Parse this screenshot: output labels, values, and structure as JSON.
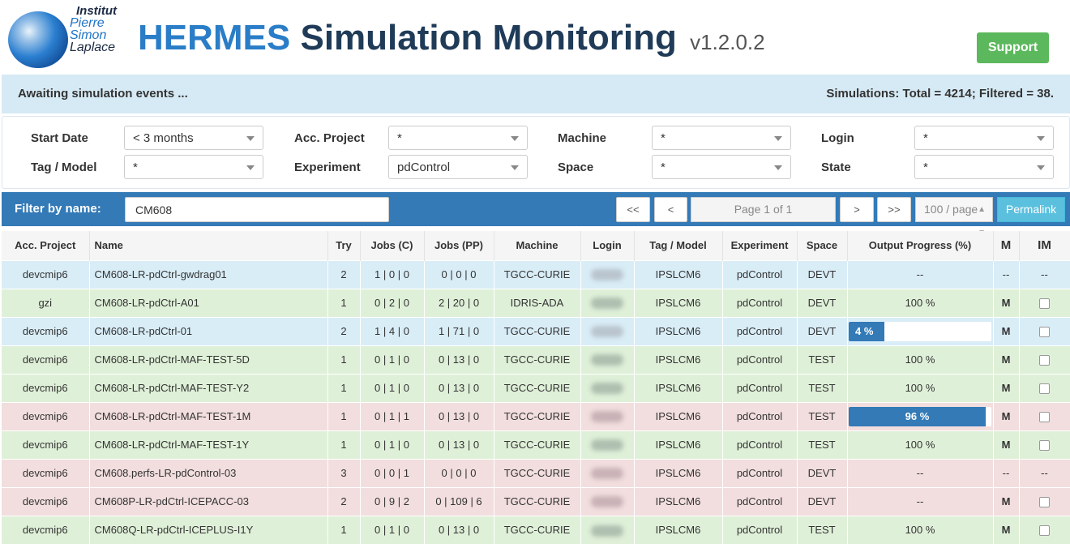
{
  "header": {
    "logo_lines": [
      "Institut",
      "Pierre",
      "Simon",
      "Laplace"
    ],
    "title_part1": "HERMES",
    "title_part2": "Simulation Monitoring",
    "version": "v1.2.0.2",
    "support_label": "Support"
  },
  "status": {
    "left": "Awaiting simulation events ...",
    "right": "Simulations: Total = 4214; Filtered = 38."
  },
  "filters": {
    "start_date": {
      "label": "Start Date",
      "value": "< 3 months"
    },
    "acc_project": {
      "label": "Acc. Project",
      "value": "*"
    },
    "machine": {
      "label": "Machine",
      "value": "*"
    },
    "login": {
      "label": "Login",
      "value": "*"
    },
    "tag_model": {
      "label": "Tag / Model",
      "value": "*"
    },
    "experiment": {
      "label": "Experiment",
      "value": "pdControl"
    },
    "space": {
      "label": "Space",
      "value": "*"
    },
    "state": {
      "label": "State",
      "value": "*"
    }
  },
  "nav": {
    "filter_label": "Filter by name:",
    "filter_value": "CM608",
    "first": "<<",
    "prev": "<",
    "page_info": "Page 1 of 1",
    "next": ">",
    "last": ">>",
    "per_page": "100 / page",
    "permalink": "Permalink"
  },
  "table": {
    "columns": [
      "Acc. Project",
      "Name",
      "Try",
      "Jobs (C)",
      "Jobs (PP)",
      "Machine",
      "Login",
      "Tag / Model",
      "Experiment",
      "Space",
      "Output Progress (%)",
      "M",
      "IM"
    ],
    "rows": [
      {
        "status": "blue",
        "project": "devcmip6",
        "name": "CM608-LR-pdCtrl-gwdrag01",
        "try": "2",
        "jobs_c": "1 | 0 | 0",
        "jobs_pp": "0 | 0 | 0",
        "machine": "TGCC-CURIE",
        "tag": "IPSLCM6",
        "experiment": "pdControl",
        "space": "DEVT",
        "progress_text": "--",
        "progress_value": null,
        "m": "--",
        "im": "--"
      },
      {
        "status": "green",
        "project": "gzi",
        "name": "CM608-LR-pdCtrl-A01",
        "try": "1",
        "jobs_c": "0 | 2 | 0",
        "jobs_pp": "2 | 20 | 0",
        "machine": "IDRIS-ADA",
        "tag": "IPSLCM6",
        "experiment": "pdControl",
        "space": "DEVT",
        "progress_text": "100 %",
        "progress_value": null,
        "m": "M",
        "im": "checkbox"
      },
      {
        "status": "blue",
        "project": "devcmip6",
        "name": "CM608-LR-pdCtrl-01",
        "try": "2",
        "jobs_c": "1 | 4 | 0",
        "jobs_pp": "1 | 71 | 0",
        "machine": "TGCC-CURIE",
        "tag": "IPSLCM6",
        "experiment": "pdControl",
        "space": "DEVT",
        "progress_text": "4 %",
        "progress_value": 4,
        "m": "M",
        "im": "checkbox"
      },
      {
        "status": "green",
        "project": "devcmip6",
        "name": "CM608-LR-pdCtrl-MAF-TEST-5D",
        "try": "1",
        "jobs_c": "0 | 1 | 0",
        "jobs_pp": "0 | 13 | 0",
        "machine": "TGCC-CURIE",
        "tag": "IPSLCM6",
        "experiment": "pdControl",
        "space": "TEST",
        "progress_text": "100 %",
        "progress_value": null,
        "m": "M",
        "im": "checkbox"
      },
      {
        "status": "green",
        "project": "devcmip6",
        "name": "CM608-LR-pdCtrl-MAF-TEST-Y2",
        "try": "1",
        "jobs_c": "0 | 1 | 0",
        "jobs_pp": "0 | 13 | 0",
        "machine": "TGCC-CURIE",
        "tag": "IPSLCM6",
        "experiment": "pdControl",
        "space": "TEST",
        "progress_text": "100 %",
        "progress_value": null,
        "m": "M",
        "im": "checkbox"
      },
      {
        "status": "red",
        "project": "devcmip6",
        "name": "CM608-LR-pdCtrl-MAF-TEST-1M",
        "try": "1",
        "jobs_c": "0 | 1 | 1",
        "jobs_pp": "0 | 13 | 0",
        "machine": "TGCC-CURIE",
        "tag": "IPSLCM6",
        "experiment": "pdControl",
        "space": "TEST",
        "progress_text": "96 %",
        "progress_value": 96,
        "m": "M",
        "im": "checkbox"
      },
      {
        "status": "green",
        "project": "devcmip6",
        "name": "CM608-LR-pdCtrl-MAF-TEST-1Y",
        "try": "1",
        "jobs_c": "0 | 1 | 0",
        "jobs_pp": "0 | 13 | 0",
        "machine": "TGCC-CURIE",
        "tag": "IPSLCM6",
        "experiment": "pdControl",
        "space": "TEST",
        "progress_text": "100 %",
        "progress_value": null,
        "m": "M",
        "im": "checkbox"
      },
      {
        "status": "red",
        "project": "devcmip6",
        "name": "CM608.perfs-LR-pdControl-03",
        "try": "3",
        "jobs_c": "0 | 0 | 1",
        "jobs_pp": "0 | 0 | 0",
        "machine": "TGCC-CURIE",
        "tag": "IPSLCM6",
        "experiment": "pdControl",
        "space": "DEVT",
        "progress_text": "--",
        "progress_value": null,
        "m": "--",
        "im": "--"
      },
      {
        "status": "red",
        "project": "devcmip6",
        "name": "CM608P-LR-pdCtrl-ICEPACC-03",
        "try": "2",
        "jobs_c": "0 | 9 | 2",
        "jobs_pp": "0 | 109 | 6",
        "machine": "TGCC-CURIE",
        "tag": "IPSLCM6",
        "experiment": "pdControl",
        "space": "DEVT",
        "progress_text": "--",
        "progress_value": null,
        "m": "M",
        "im": "checkbox"
      },
      {
        "status": "green",
        "project": "devcmip6",
        "name": "CM608Q-LR-pdCtrl-ICEPLUS-I1Y",
        "try": "1",
        "jobs_c": "0 | 1 | 0",
        "jobs_pp": "0 | 13 | 0",
        "machine": "TGCC-CURIE",
        "tag": "IPSLCM6",
        "experiment": "pdControl",
        "space": "TEST",
        "progress_text": "100 %",
        "progress_value": null,
        "m": "M",
        "im": "checkbox"
      }
    ]
  },
  "colors": {
    "brand_blue": "#2a7dc7",
    "navbar": "#337ab7",
    "support": "#5cb85c",
    "permalink": "#5bc0de",
    "row_blue": "#d9edf7",
    "row_green": "#dff0d8",
    "row_red": "#f2dede"
  }
}
